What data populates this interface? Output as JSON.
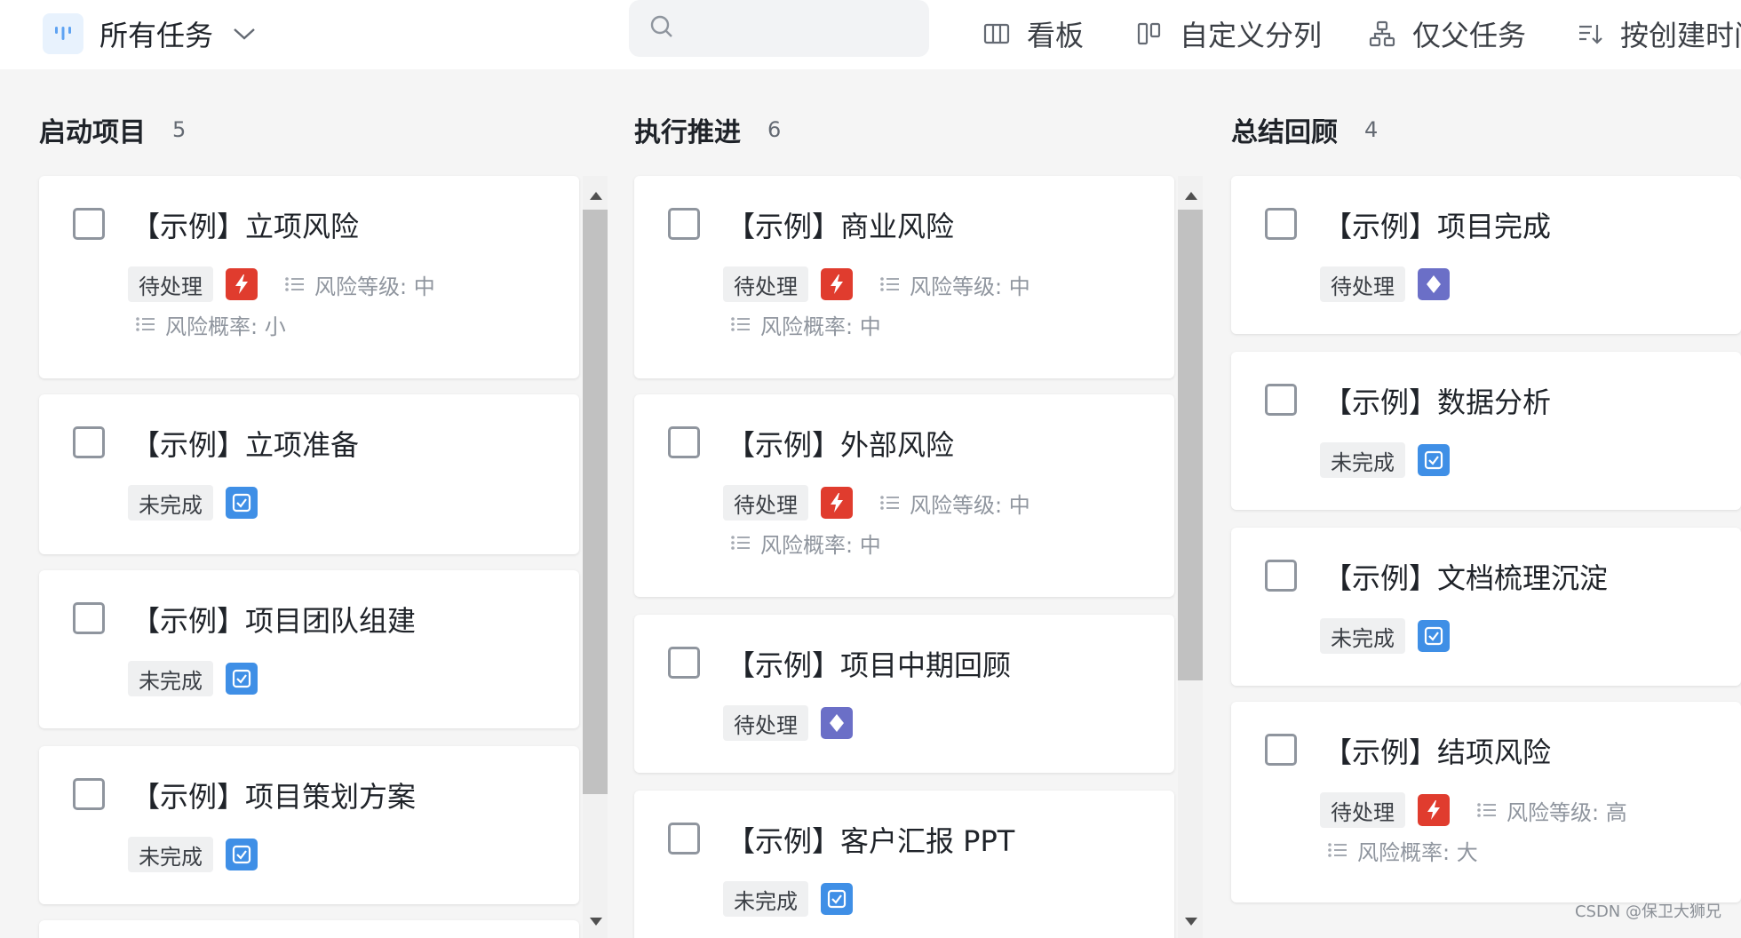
{
  "toolbar": {
    "view_title": "所有任务",
    "view_icon": "board-view-icon",
    "search_placeholder": "",
    "tools": {
      "board": "看板",
      "custom_group": "自定义分列",
      "parent_only": "仅父任务",
      "sort": "按创建时间"
    }
  },
  "colors": {
    "risk": "#e03c2e",
    "task": "#3f8fe6",
    "milestone": "#6b6fc7",
    "accent": "#3f8fe6"
  },
  "columns": [
    {
      "name": "启动项目",
      "count": "5",
      "cards": [
        {
          "title": "【示例】立项风险",
          "status": "待处理",
          "type": "risk",
          "fields": [
            "风险等级: 中",
            "风险概率: 小"
          ]
        },
        {
          "title": "【示例】立项准备",
          "status": "未完成",
          "type": "task",
          "fields": []
        },
        {
          "title": "【示例】项目团队组建",
          "status": "未完成",
          "type": "task",
          "fields": []
        },
        {
          "title": "【示例】项目策划方案",
          "status": "未完成",
          "type": "task",
          "fields": []
        }
      ]
    },
    {
      "name": "执行推进",
      "count": "6",
      "cards": [
        {
          "title": "【示例】商业风险",
          "status": "待处理",
          "type": "risk",
          "fields": [
            "风险等级: 中",
            "风险概率: 中"
          ]
        },
        {
          "title": "【示例】外部风险",
          "status": "待处理",
          "type": "risk",
          "fields": [
            "风险等级: 中",
            "风险概率: 中"
          ]
        },
        {
          "title": "【示例】项目中期回顾",
          "status": "待处理",
          "type": "milestone",
          "fields": []
        },
        {
          "title": "【示例】客户汇报 PPT",
          "status": "未完成",
          "type": "task",
          "fields": []
        }
      ]
    },
    {
      "name": "总结回顾",
      "count": "4",
      "cards": [
        {
          "title": "【示例】项目完成",
          "status": "待处理",
          "type": "milestone",
          "fields": []
        },
        {
          "title": "【示例】数据分析",
          "status": "未完成",
          "type": "task",
          "fields": []
        },
        {
          "title": "【示例】文档梳理沉淀",
          "status": "未完成",
          "type": "task",
          "fields": []
        },
        {
          "title": "【示例】结项风险",
          "status": "待处理",
          "type": "risk",
          "fields": [
            "风险等级: 高",
            "风险概率: 大"
          ]
        }
      ]
    }
  ],
  "watermark": "CSDN @保卫大狮兄"
}
